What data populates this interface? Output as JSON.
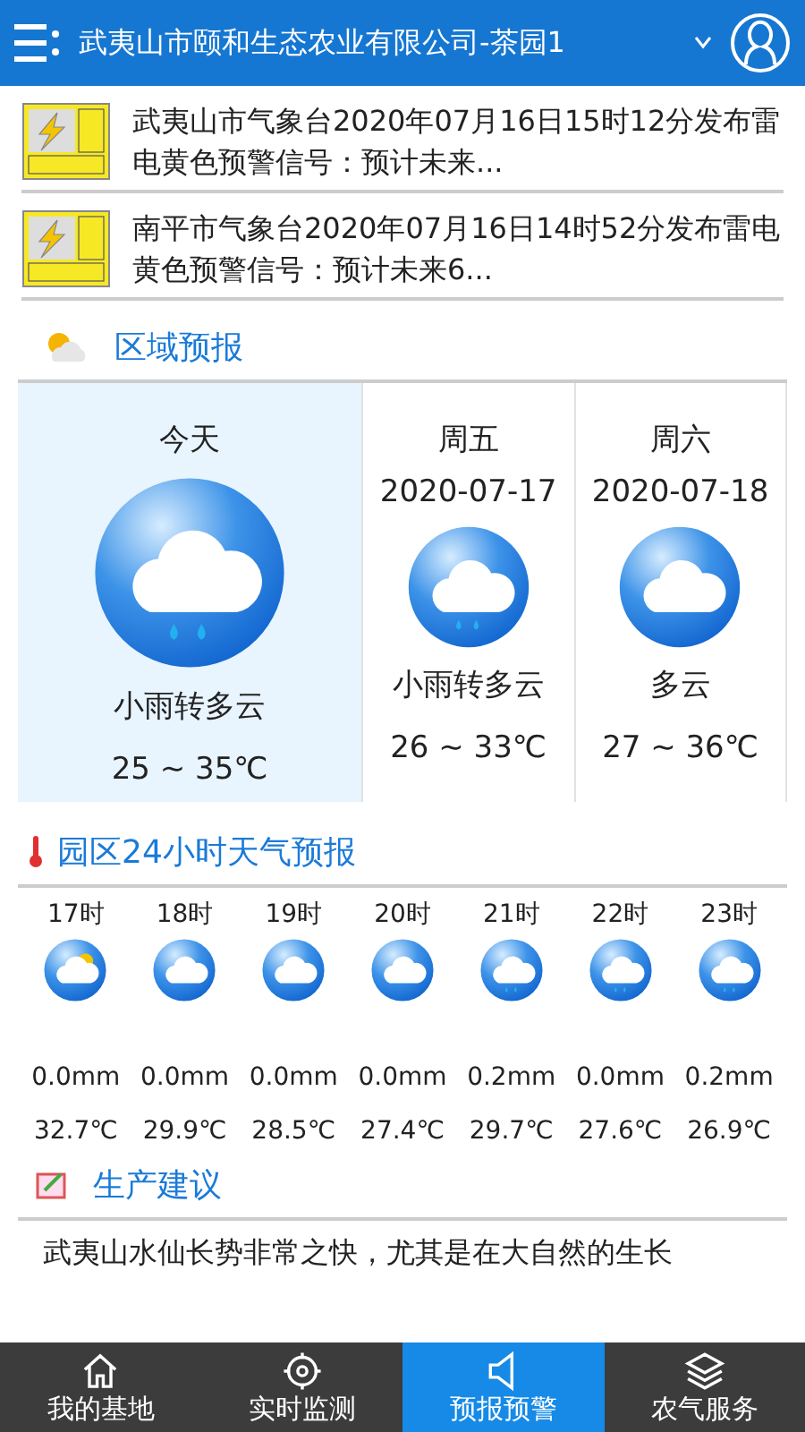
{
  "header": {
    "title": "武夷山市颐和生态农业有限公司-茶园1"
  },
  "alerts": [
    {
      "text": "武夷山市气象台2020年07月16日15时12分发布雷电黄色预警信号：预计未来..."
    },
    {
      "text": "南平市气象台2020年07月16日14时52分发布雷电黄色预警信号：预计未来6..."
    }
  ],
  "regional": {
    "title": "区域预报",
    "days": [
      {
        "day": "今天",
        "selected": true,
        "kind": "rain",
        "weather": "小雨转多云",
        "temp": "25 ~ 35℃"
      },
      {
        "day": "周五",
        "date": "2020-07-17",
        "selected": false,
        "kind": "rain",
        "weather": "小雨转多云",
        "temp": "26 ~ 33℃"
      },
      {
        "day": "周六",
        "date": "2020-07-18",
        "selected": false,
        "kind": "cloud",
        "weather": "多云",
        "temp": "27 ~ 36℃"
      }
    ]
  },
  "hourly": {
    "title": "园区24小时天气预报",
    "hours": [
      {
        "time": "17时",
        "kind": "sun_cloud",
        "rain": "0.0mm",
        "temp": "32.7℃"
      },
      {
        "time": "18时",
        "kind": "cloud",
        "rain": "0.0mm",
        "temp": "29.9℃"
      },
      {
        "time": "19时",
        "kind": "cloud",
        "rain": "0.0mm",
        "temp": "28.5℃"
      },
      {
        "time": "20时",
        "kind": "cloud",
        "rain": "0.0mm",
        "temp": "27.4℃"
      },
      {
        "time": "21时",
        "kind": "rain",
        "rain": "0.2mm",
        "temp": "29.7℃"
      },
      {
        "time": "22时",
        "kind": "rain",
        "rain": "0.0mm",
        "temp": "27.6℃"
      },
      {
        "time": "23时",
        "kind": "rain",
        "rain": "0.2mm",
        "temp": "26.9℃"
      }
    ]
  },
  "advice": {
    "title": "生产建议",
    "text": "武夷山水仙长势非常之快，尤其是在大自然的生长"
  },
  "nav": [
    {
      "label": "我的基地",
      "kind": "home",
      "selected": false
    },
    {
      "label": "实时监测",
      "kind": "target",
      "selected": false
    },
    {
      "label": "预报预警",
      "kind": "speaker",
      "selected": true
    },
    {
      "label": "农气服务",
      "kind": "layers",
      "selected": false
    }
  ]
}
